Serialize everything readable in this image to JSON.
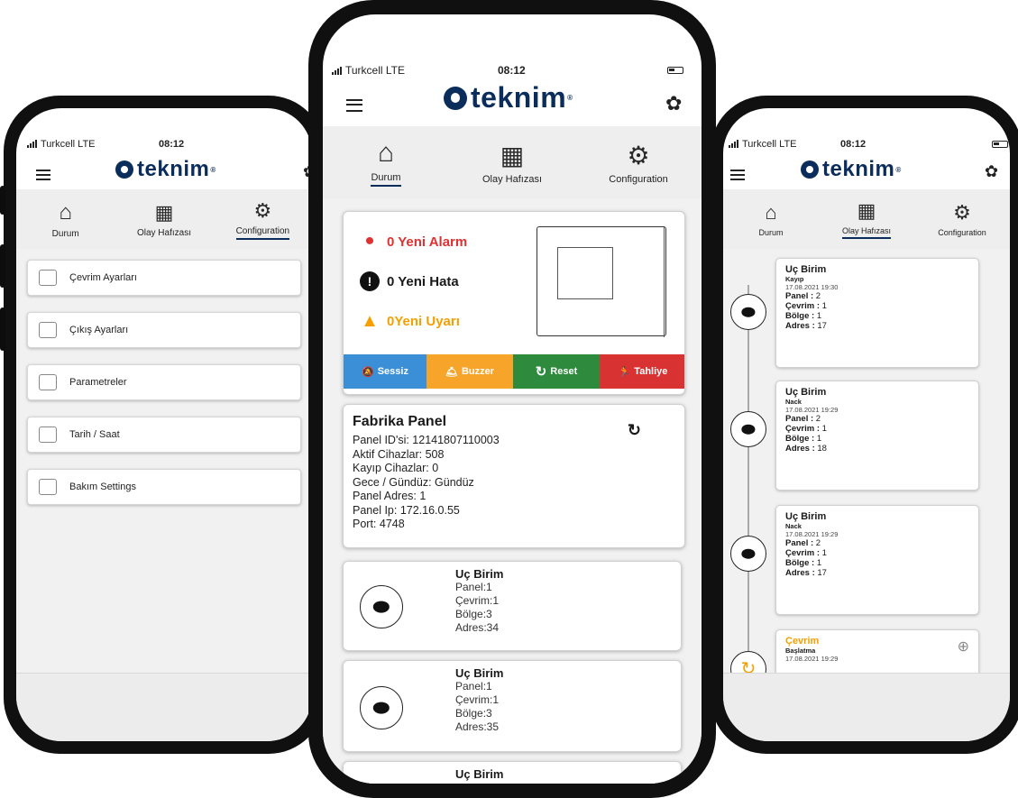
{
  "status": {
    "carrier": "Turkcell LTE",
    "time": "08:12"
  },
  "brand": {
    "name": "teknim",
    "reg": "®"
  },
  "tabs": {
    "durum": "Durum",
    "olay": "Olay Hafızası",
    "config": "Configuration"
  },
  "left_menu": [
    "Çevrim Ayarları",
    "Çıkış Ayarları",
    "Parametreler",
    "Tarih / Saat",
    "Bakım Settings"
  ],
  "summary": {
    "alarm": "0 Yeni Alarm",
    "hata": "0 Yeni Hata",
    "uyari": "0Yeni Uyarı",
    "colors": {
      "alarm": "#e03131",
      "hata": "#111111",
      "uyari": "#f59f00"
    }
  },
  "actions": [
    {
      "label": "Sessiz",
      "color": "#3b8fd6",
      "icon": "bell-slash-icon"
    },
    {
      "label": "Buzzer",
      "color": "#f7a52a",
      "icon": "buzzer-icon"
    },
    {
      "label": "Reset",
      "color": "#2e8b3d",
      "icon": "refresh-icon"
    },
    {
      "label": "Tahliye",
      "color": "#d93232",
      "icon": "running-person-icon"
    }
  ],
  "panel": {
    "name": "Fabrika Panel",
    "lines": [
      "Panel ID'si: 12141807110003",
      "Aktif Cihazlar: 508",
      "Kayıp Cihazlar: 0",
      "Gece / Gündüz: Gündüz",
      "Panel Adres: 1",
      "Panel Ip: 172.16.0.55",
      "Port: 4748"
    ]
  },
  "devices": [
    {
      "title": "Uç Birim",
      "lines": [
        "Panel:1",
        "Çevrim:1",
        "Bölge:3",
        "Adres:34"
      ]
    },
    {
      "title": "Uç Birim",
      "lines": [
        "Panel:1",
        "Çevrim:1",
        "Bölge:3",
        "Adres:35"
      ]
    },
    {
      "title": "Uç Birim",
      "lines": []
    }
  ],
  "timeline": [
    {
      "title": "Uç Birim",
      "sub": "Kayıp",
      "date": "17.08.2021 19:30",
      "panel": "2",
      "cevrim": "1",
      "bolge": "1",
      "adres": "17"
    },
    {
      "title": "Uç Birim",
      "sub": "Nack",
      "date": "17.08.2021 19:29",
      "panel": "2",
      "cevrim": "1",
      "bolge": "1",
      "adres": "18"
    },
    {
      "title": "Uç Birim",
      "sub": "Nack",
      "date": "17.08.2021 19:29",
      "panel": "2",
      "cevrim": "1",
      "bolge": "1",
      "adres": "17"
    },
    {
      "title": "Çevrim",
      "sub": "Başlatma",
      "date": "17.08.2021 19:29"
    }
  ],
  "field_labels": {
    "panel": "Panel : ",
    "cevrim": "Çevrim : ",
    "bolge": "Bölge : ",
    "adres": "Adres : "
  }
}
